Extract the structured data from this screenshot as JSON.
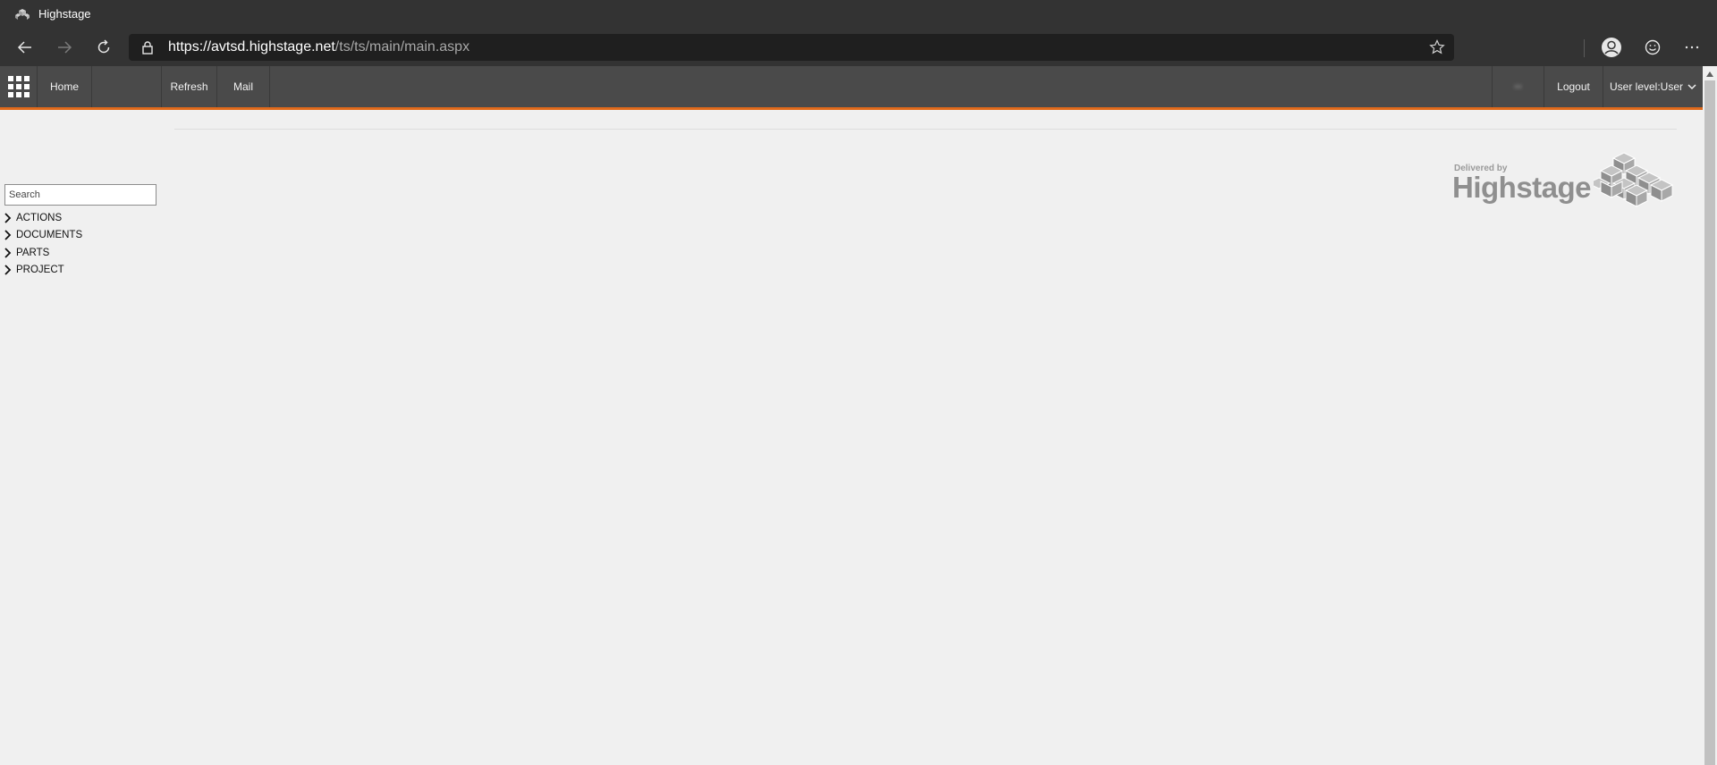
{
  "browser": {
    "tab_title": "Highstage",
    "url_host": "https://avtsd.highstage.net",
    "url_path": "/ts/ts/main/main.aspx"
  },
  "topmenu": {
    "items": [
      "Home",
      "Refresh",
      "Mail"
    ],
    "blurred_user": "••",
    "logout_label": "Logout",
    "user_level_label": "User level:User"
  },
  "sidebar": {
    "search_placeholder": "Search",
    "tree": [
      "ACTIONS",
      "DOCUMENTS",
      "PARTS",
      "PROJECT"
    ]
  },
  "logo": {
    "delivered_by": "Delivered by",
    "brand": "Highstage"
  },
  "colors": {
    "accent": "#e06a1b",
    "menu_bg": "#4a4a4a",
    "chrome_bg": "#333333",
    "page_bg": "#f0f0f0"
  }
}
